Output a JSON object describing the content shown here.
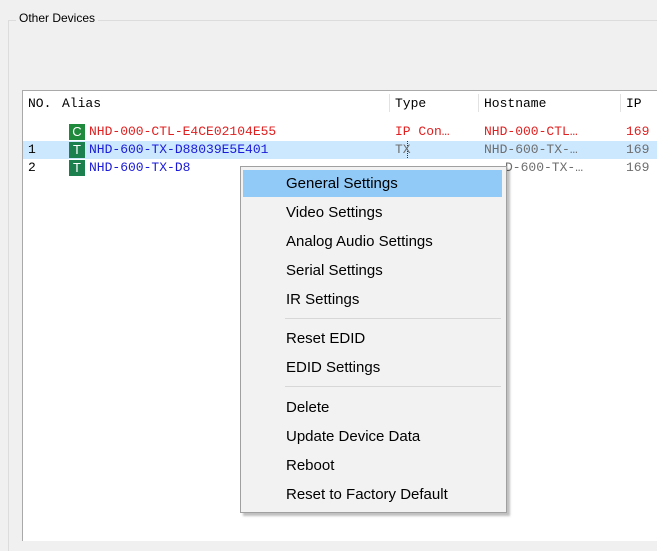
{
  "group": {
    "title": "Other Devices"
  },
  "table": {
    "headers": [
      "NO.",
      "Alias",
      "Type",
      "Hostname",
      "IP"
    ],
    "rows": [
      {
        "no": "",
        "badge": "C",
        "alias": "NHD-000-CTL-E4CE02104E55",
        "type": "IP Con…",
        "hostname": "NHD-000-CTL…",
        "ip": "169"
      },
      {
        "no": "1",
        "badge": "T",
        "alias": "NHD-600-TX-D88039E5E401",
        "type": "TX",
        "hostname": "NHD-600-TX-…",
        "ip": "169"
      },
      {
        "no": "2",
        "badge": "T",
        "alias": "NHD-600-TX-D8",
        "type": "",
        "hostname": "D-600-TX-…",
        "ip": "169"
      }
    ]
  },
  "context_menu": {
    "items": [
      "General Settings",
      "Video Settings",
      "Analog Audio Settings",
      "Serial Settings",
      "IR Settings",
      "Reset EDID",
      "EDID Settings",
      "Delete",
      "Update Device Data",
      "Reboot",
      "Reset to Factory Default"
    ]
  },
  "colors": {
    "controller_text": "#e02020",
    "tx_text": "#1a1ad8",
    "selection": "#cce8ff",
    "menu_hover": "#91c9f7",
    "badge_green": "#1f8a3b"
  }
}
